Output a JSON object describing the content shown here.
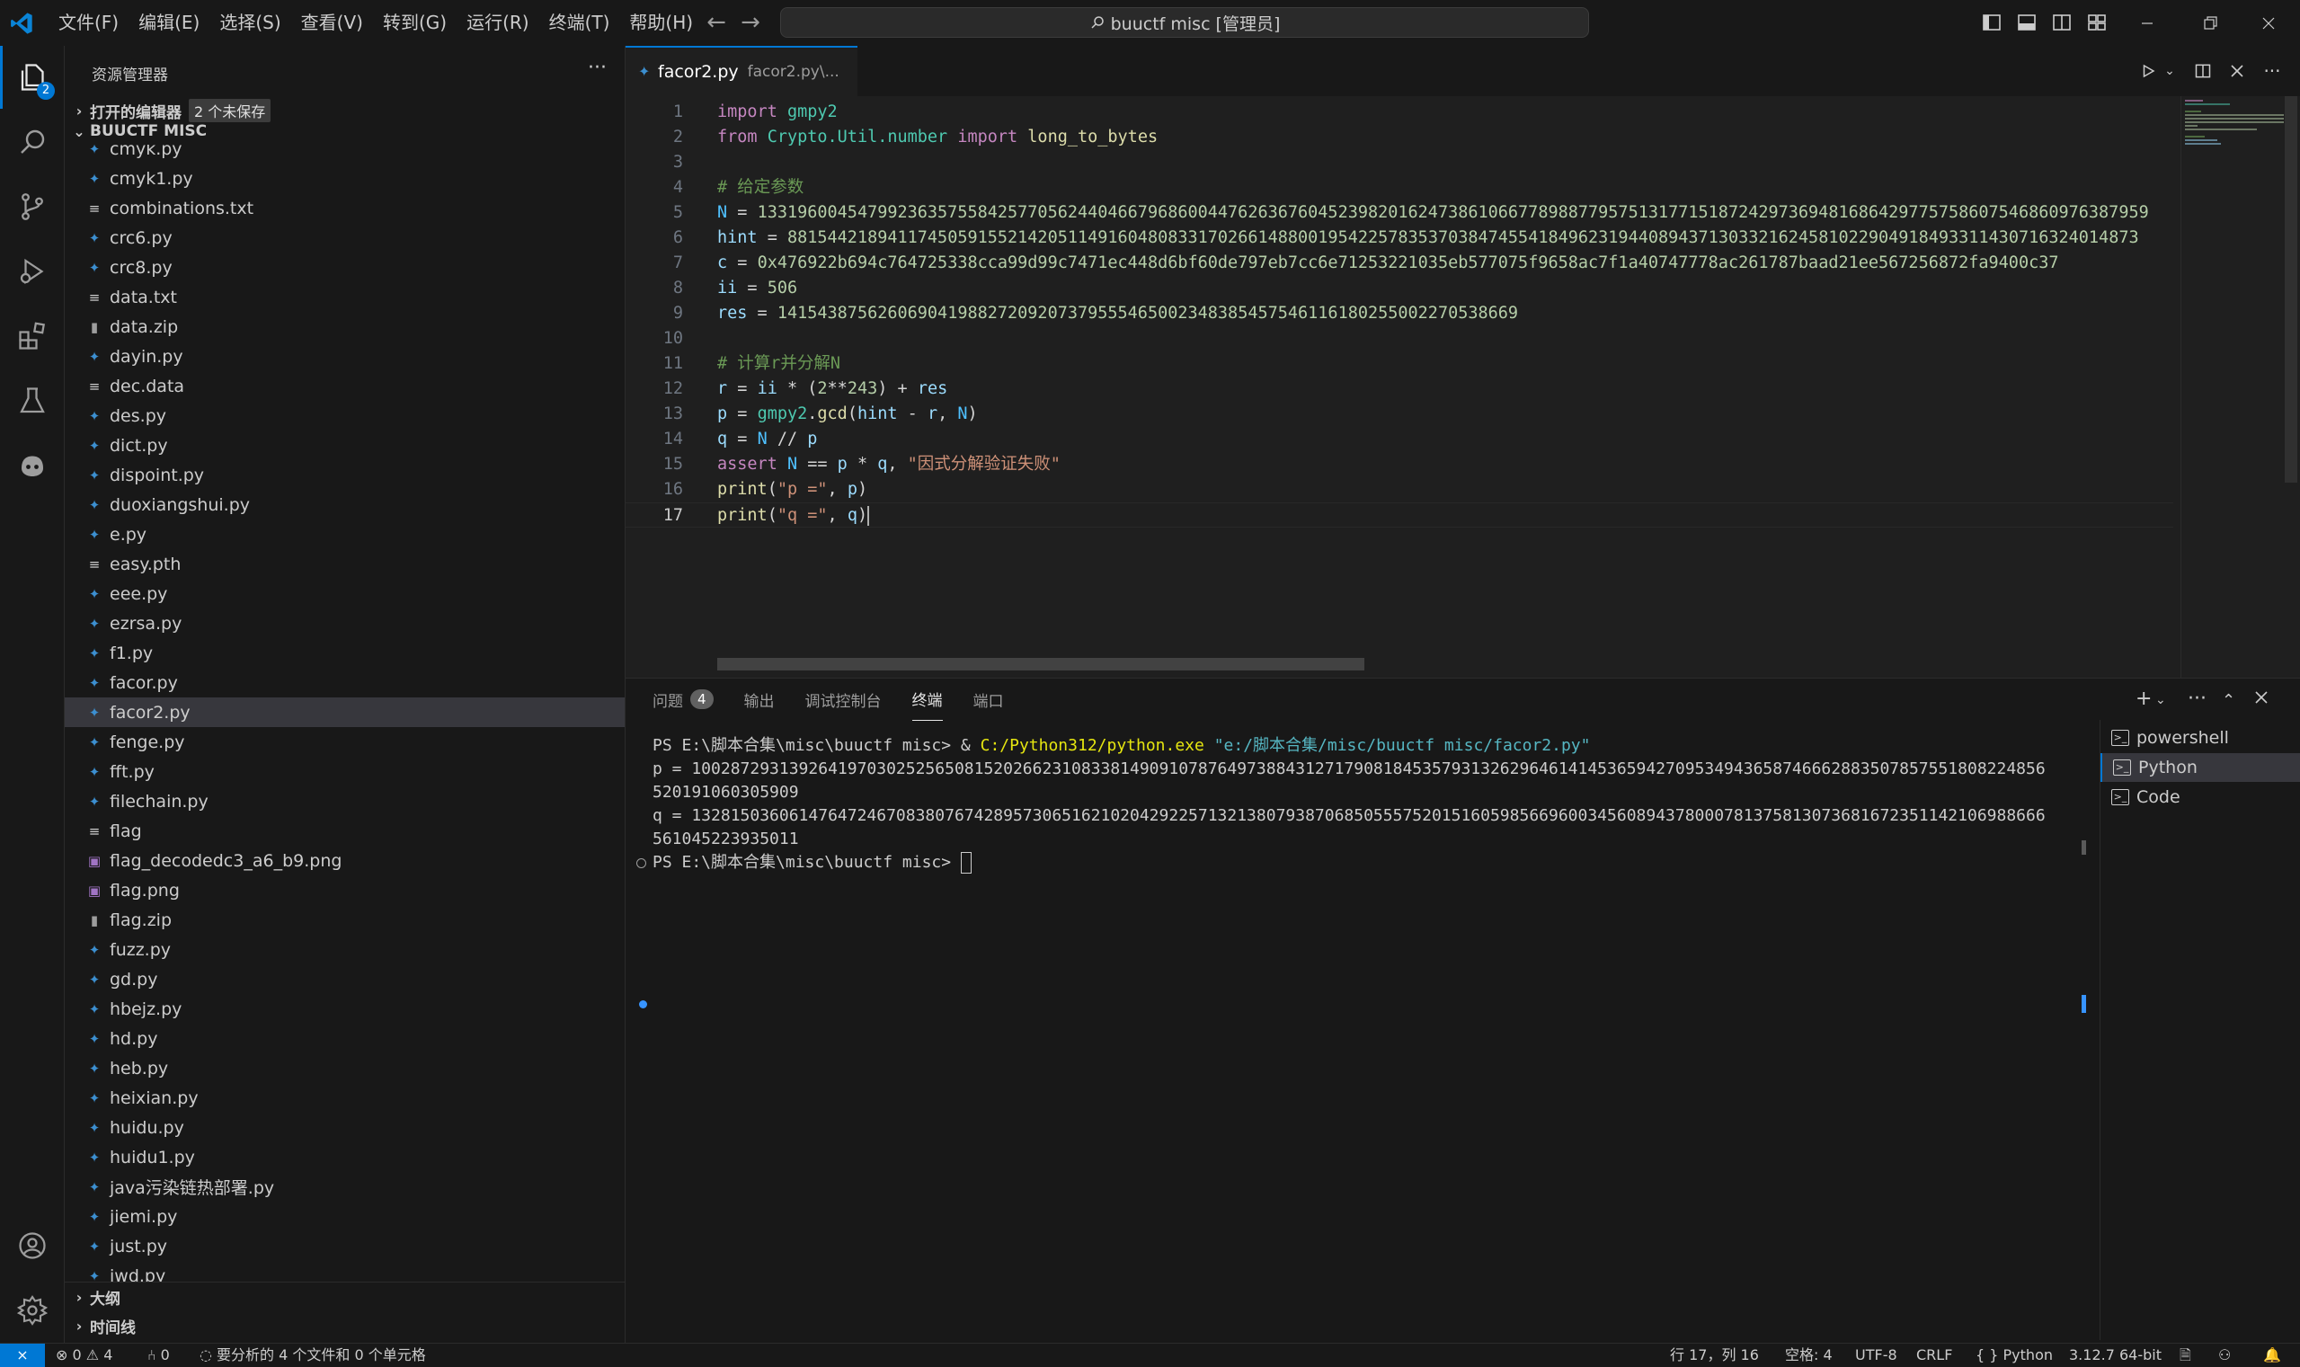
{
  "titlebar": {
    "menus": [
      "文件(F)",
      "编辑(E)",
      "选择(S)",
      "查看(V)",
      "转到(G)",
      "运行(R)",
      "终端(T)",
      "帮助(H)"
    ],
    "search": "buuctf misc [管理员]"
  },
  "activitybar": {
    "explorer_badge": "2",
    "items": [
      "files-icon",
      "search-icon",
      "source-control-icon",
      "run-debug-icon",
      "extensions-icon",
      "testing-icon",
      "copilot-icon",
      "account-icon",
      "settings-gear-icon"
    ]
  },
  "sidebar": {
    "title": "资源管理器",
    "open_editors": {
      "label": "打开的编辑器",
      "badge": "2 个未保存"
    },
    "folder": "BUUCTF MISC",
    "files": [
      {
        "name": "cmyk.py",
        "type": "py"
      },
      {
        "name": "cmyk1.py",
        "type": "py"
      },
      {
        "name": "combinations.txt",
        "type": "txt"
      },
      {
        "name": "crc6.py",
        "type": "py"
      },
      {
        "name": "crc8.py",
        "type": "py"
      },
      {
        "name": "data.txt",
        "type": "txt"
      },
      {
        "name": "data.zip",
        "type": "zip"
      },
      {
        "name": "dayin.py",
        "type": "py"
      },
      {
        "name": "dec.data",
        "type": "txt"
      },
      {
        "name": "des.py",
        "type": "py"
      },
      {
        "name": "dict.py",
        "type": "py"
      },
      {
        "name": "dispoint.py",
        "type": "py"
      },
      {
        "name": "duoxiangshui.py",
        "type": "py"
      },
      {
        "name": "e.py",
        "type": "py"
      },
      {
        "name": "easy.pth",
        "type": "txt"
      },
      {
        "name": "eee.py",
        "type": "py"
      },
      {
        "name": "ezrsa.py",
        "type": "py"
      },
      {
        "name": "f1.py",
        "type": "py"
      },
      {
        "name": "facor.py",
        "type": "py"
      },
      {
        "name": "facor2.py",
        "type": "py",
        "active": true
      },
      {
        "name": "fenge.py",
        "type": "py"
      },
      {
        "name": "fft.py",
        "type": "py"
      },
      {
        "name": "filechain.py",
        "type": "py"
      },
      {
        "name": "flag",
        "type": "txt"
      },
      {
        "name": "flag_decodedc3_a6_b9.png",
        "type": "png"
      },
      {
        "name": "flag.png",
        "type": "png"
      },
      {
        "name": "flag.zip",
        "type": "zip"
      },
      {
        "name": "fuzz.py",
        "type": "py"
      },
      {
        "name": "gd.py",
        "type": "py"
      },
      {
        "name": "hbejz.py",
        "type": "py"
      },
      {
        "name": "hd.py",
        "type": "py"
      },
      {
        "name": "heb.py",
        "type": "py"
      },
      {
        "name": "heixian.py",
        "type": "py"
      },
      {
        "name": "huidu.py",
        "type": "py"
      },
      {
        "name": "huidu1.py",
        "type": "py"
      },
      {
        "name": "java污染链热部署.py",
        "type": "py"
      },
      {
        "name": "jiemi.py",
        "type": "py"
      },
      {
        "name": "just.py",
        "type": "py"
      },
      {
        "name": "jwd.py",
        "type": "py"
      }
    ],
    "outline": "大纲",
    "timeline": "时间线"
  },
  "editor": {
    "tab": {
      "label": "facor2.py",
      "description": "facor2.py\\..."
    },
    "current_line": 17,
    "lines": [
      [
        [
          "kw",
          "import"
        ],
        [
          "op",
          " "
        ],
        [
          "mod",
          "gmpy2"
        ]
      ],
      [
        [
          "kw",
          "from"
        ],
        [
          "op",
          " "
        ],
        [
          "mod",
          "Crypto.Util.number"
        ],
        [
          "op",
          " "
        ],
        [
          "kw",
          "import"
        ],
        [
          "op",
          " "
        ],
        [
          "fn",
          "long_to_bytes"
        ]
      ],
      [],
      [
        [
          "cmt",
          "# 给定参数"
        ]
      ],
      [
        [
          "const",
          "N"
        ],
        [
          "op",
          " = "
        ],
        [
          "num",
          "1331960045479923635755842577056244046679686004476263676045239820162473861066778988779575131771518724297369481686429775758607546860976387959"
        ]
      ],
      [
        [
          "id",
          "hint"
        ],
        [
          "op",
          " = "
        ],
        [
          "num",
          "881544218941174505915521420511491604808331702661488001954225783537038474554184962319440894371303321624581022904918493311430716324014873"
        ]
      ],
      [
        [
          "id",
          "c"
        ],
        [
          "op",
          " = "
        ],
        [
          "num",
          "0x"
        ],
        [
          "num",
          "476922b694c764725338cca99d99c7471ec448d6bf60de797eb7cc6e71253221035eb577075f9658ac7f1a40747778ac261787baad21ee567256872fa9400c37"
        ]
      ],
      [
        [
          "id",
          "ii"
        ],
        [
          "op",
          " = "
        ],
        [
          "num",
          "506"
        ]
      ],
      [
        [
          "id",
          "res"
        ],
        [
          "op",
          " = "
        ],
        [
          "num",
          "14154387562606904198827209207379555465002348385457546116180255002270538669"
        ]
      ],
      [],
      [
        [
          "cmt",
          "# 计算r并分解N"
        ]
      ],
      [
        [
          "id",
          "r"
        ],
        [
          "op",
          " = "
        ],
        [
          "id",
          "ii"
        ],
        [
          "op",
          " * ("
        ],
        [
          "num",
          "2"
        ],
        [
          "op",
          "**"
        ],
        [
          "num",
          "243"
        ],
        [
          "op",
          ") + "
        ],
        [
          "id",
          "res"
        ]
      ],
      [
        [
          "id",
          "p"
        ],
        [
          "op",
          " = "
        ],
        [
          "mod",
          "gmpy2"
        ],
        [
          "op",
          "."
        ],
        [
          "fn",
          "gcd"
        ],
        [
          "op",
          "("
        ],
        [
          "id",
          "hint"
        ],
        [
          "op",
          " - "
        ],
        [
          "id",
          "r"
        ],
        [
          "op",
          ", "
        ],
        [
          "const",
          "N"
        ],
        [
          "op",
          ")"
        ]
      ],
      [
        [
          "id",
          "q"
        ],
        [
          "op",
          " = "
        ],
        [
          "const",
          "N"
        ],
        [
          "op",
          " // "
        ],
        [
          "id",
          "p"
        ]
      ],
      [
        [
          "kw",
          "assert"
        ],
        [
          "op",
          " "
        ],
        [
          "const",
          "N"
        ],
        [
          "op",
          " == "
        ],
        [
          "id",
          "p"
        ],
        [
          "op",
          " * "
        ],
        [
          "id",
          "q"
        ],
        [
          "op",
          ", "
        ],
        [
          "str",
          "\"因式分解验证失败\""
        ]
      ],
      [
        [
          "fn",
          "print"
        ],
        [
          "op",
          "("
        ],
        [
          "str",
          "\"p =\""
        ],
        [
          "op",
          ", "
        ],
        [
          "id",
          "p"
        ],
        [
          "op",
          ")"
        ]
      ],
      [
        [
          "fn",
          "print"
        ],
        [
          "op",
          "("
        ],
        [
          "str",
          "\"q =\""
        ],
        [
          "op",
          ", "
        ],
        [
          "id",
          "q"
        ],
        [
          "op",
          ")"
        ]
      ]
    ]
  },
  "panel": {
    "tabs": [
      "问题",
      "输出",
      "调试控制台",
      "终端",
      "端口"
    ],
    "problems_count": "4",
    "active_tab": "终端",
    "terminal": {
      "prompt1": "PS E:\\脚本合集\\misc\\buuctf misc> & ",
      "exe": "C:/Python312/python.exe",
      "script": "\"e:/脚本合集/misc/buuctf misc/facor2.py\"",
      "p_line1": "p = 1002872931392641970302525650815202662310833814909107876497388431271790818453579313262964614145365942709534943658746662883507857551808224856",
      "p_line2": "520191060305909",
      "q_line1": "q = 1328150360614764724670838076742895730651621020429225713213807938706850555752015160598566960034560894378000781375813073681672351142106988666",
      "q_line2": "561045223935011",
      "prompt2": "PS E:\\脚本合集\\misc\\buuctf misc> "
    },
    "terminal_list": [
      "powershell",
      "Python",
      "Code"
    ],
    "active_terminal": "Python"
  },
  "statusbar": {
    "problems": "⊗ 0 ⚠ 4",
    "ports": "⑃ 0",
    "analysis": "要分析的 4 个文件和 0 个单元格",
    "position": "行 17，列 16",
    "indent": "空格: 4",
    "encoding": "UTF-8",
    "eol": "CRLF",
    "language": "{ } Python",
    "interpreter": "3.12.7 64-bit"
  },
  "colors": {
    "accent": "#0078d4",
    "background": "#1f1f1f",
    "sidebar": "#181818"
  }
}
